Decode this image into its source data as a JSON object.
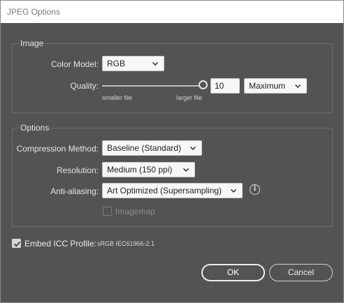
{
  "window": {
    "title": "JPEG Options"
  },
  "image_group": {
    "label": "Image",
    "color_model": {
      "label": "Color Model:",
      "value": "RGB"
    },
    "quality": {
      "label": "Quality:",
      "value": "10",
      "slider_fraction": 1.0,
      "min_hint": "smaller file",
      "max_hint": "larger file",
      "preset": "Maximum"
    }
  },
  "options_group": {
    "label": "Options",
    "compression": {
      "label": "Compression Method:",
      "value": "Baseline (Standard)"
    },
    "resolution": {
      "label": "Resolution:",
      "value": "Medium (150 ppi)"
    },
    "antialiasing": {
      "label": "Anti-aliasing:",
      "value": "Art Optimized (Supersampling)"
    },
    "imagemap": {
      "label": "Imagemap",
      "checked": false,
      "enabled": false
    }
  },
  "icc": {
    "label": "Embed ICC Profile:",
    "profile": "sRGB IEC61966-2.1",
    "checked": true
  },
  "buttons": {
    "ok": "OK",
    "cancel": "Cancel"
  },
  "icons": {
    "dropdown": "chevron-down-icon",
    "info": "info-icon",
    "check": "checkmark-icon"
  }
}
